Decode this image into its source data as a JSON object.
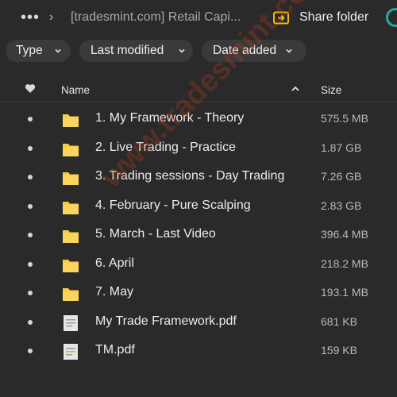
{
  "topbar": {
    "more_icon": "ellipsis-icon",
    "separator_icon": "chevron-right-icon",
    "breadcrumb": "[tradesmint.com] Retail Capi...",
    "share_icon": "share-folder-icon",
    "share_label": "Share folder"
  },
  "filters": [
    {
      "label": "Type"
    },
    {
      "label": "Last modified"
    },
    {
      "label": "Date added"
    }
  ],
  "header": {
    "favorite_icon": "heart-icon",
    "name": "Name",
    "sort_icon": "sort-ascending-icon",
    "size": "Size"
  },
  "files": [
    {
      "name": "1. My Framework - Theory",
      "size": "575.5 MB",
      "kind": "folder"
    },
    {
      "name": "2. Live Trading - Practice",
      "size": "1.87 GB",
      "kind": "folder"
    },
    {
      "name": "3. Trading sessions - Day Trading",
      "size": "7.26 GB",
      "kind": "folder"
    },
    {
      "name": "4. February - Pure Scalping",
      "size": "2.83 GB",
      "kind": "folder"
    },
    {
      "name": "5. March - Last Video",
      "size": "396.4 MB",
      "kind": "folder"
    },
    {
      "name": "6. April",
      "size": "218.2 MB",
      "kind": "folder"
    },
    {
      "name": "7. May",
      "size": "193.1 MB",
      "kind": "folder"
    },
    {
      "name": "My Trade Framework.pdf",
      "size": "681 KB",
      "kind": "pdf"
    },
    {
      "name": "TM.pdf",
      "size": "159 KB",
      "kind": "pdf"
    }
  ],
  "watermark": "www.tradesmint.com",
  "colors": {
    "background": "#2a2a2a",
    "chip": "#3a3a3a",
    "folder": "#f7c948",
    "share_icon": "#f5b800",
    "accent_teal": "#2aa7a1",
    "watermark": "#c83c14"
  }
}
